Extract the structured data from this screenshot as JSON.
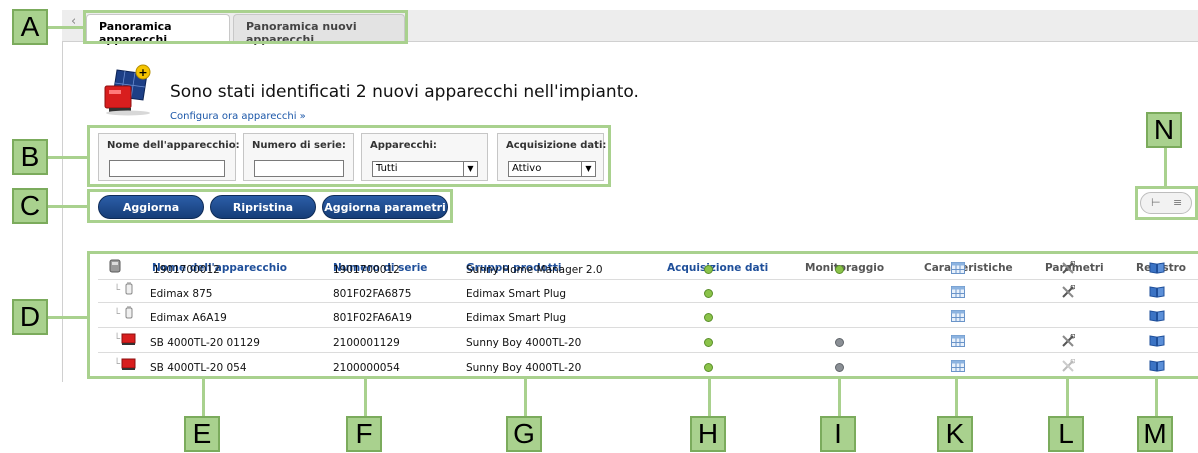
{
  "tabs": [
    {
      "label": "Panoramica apparecchi",
      "active": true
    },
    {
      "label": "Panoramica nuovi apparecchi",
      "active": false
    }
  ],
  "notice": {
    "message": "Sono stati identificati 2 nuovi apparecchi nell'impianto.",
    "link": "Configura ora apparecchi »"
  },
  "filters": {
    "device_name_label": "Nome dell'apparecchio:",
    "device_name_value": "",
    "serial_label": "Numero di serie:",
    "serial_value": "",
    "devices_label": "Apparecchi:",
    "devices_value": "Tutti",
    "acquisition_label": "Acquisizione dati:",
    "acquisition_value": "Attivo"
  },
  "buttons": {
    "refresh": "Aggiorna",
    "reset": "Ripristina",
    "update_params": "Aggiorna parametri"
  },
  "table": {
    "headers": {
      "name": "Nome dell'apparecchio",
      "serial": "Numero di serie",
      "group": "Gruppo prodotti",
      "acquisition": "Acquisizione dati",
      "monitoring": "Monitoraggio",
      "characteristics": "Caratteristiche",
      "parameters": "Parametri",
      "log": "Registro"
    },
    "rows": [
      {
        "name": "1901700012",
        "serial": "1901700012",
        "group": "Sunny Home Manager 2.0",
        "device_icon": "home-manager-icon",
        "acquisition": "green",
        "monitoring": "green",
        "parameters": true
      },
      {
        "name": "Edimax 875",
        "serial": "801F02FA6875",
        "group": "Edimax Smart Plug",
        "device_icon": "smart-plug-icon",
        "acquisition": "green",
        "monitoring": "none",
        "parameters": true
      },
      {
        "name": "Edimax A6A19",
        "serial": "801F02FA6A19",
        "group": "Edimax Smart Plug",
        "device_icon": "smart-plug-icon",
        "acquisition": "green",
        "monitoring": "none",
        "parameters": false
      },
      {
        "name": "SB 4000TL-20 01129",
        "serial": "2100001129",
        "group": "Sunny Boy 4000TL-20",
        "device_icon": "inverter-icon",
        "acquisition": "green",
        "monitoring": "grey",
        "parameters": true
      },
      {
        "name": "SB 4000TL-20 054",
        "serial": "2100000054",
        "group": "Sunny Boy 4000TL-20",
        "device_icon": "inverter-icon",
        "acquisition": "green",
        "monitoring": "grey",
        "parameters": false
      }
    ]
  },
  "callouts": {
    "A": "A",
    "B": "B",
    "C": "C",
    "D": "D",
    "E": "E",
    "F": "F",
    "G": "G",
    "H": "H",
    "I": "I",
    "K": "K",
    "L": "L",
    "M": "M",
    "N": "N"
  },
  "colors": {
    "callout_green": "#a9d18e",
    "header_blue": "#1f4f9a",
    "button_blue": "#1f4d90",
    "status_green": "#8bc34a",
    "status_grey": "#8a8f95"
  }
}
